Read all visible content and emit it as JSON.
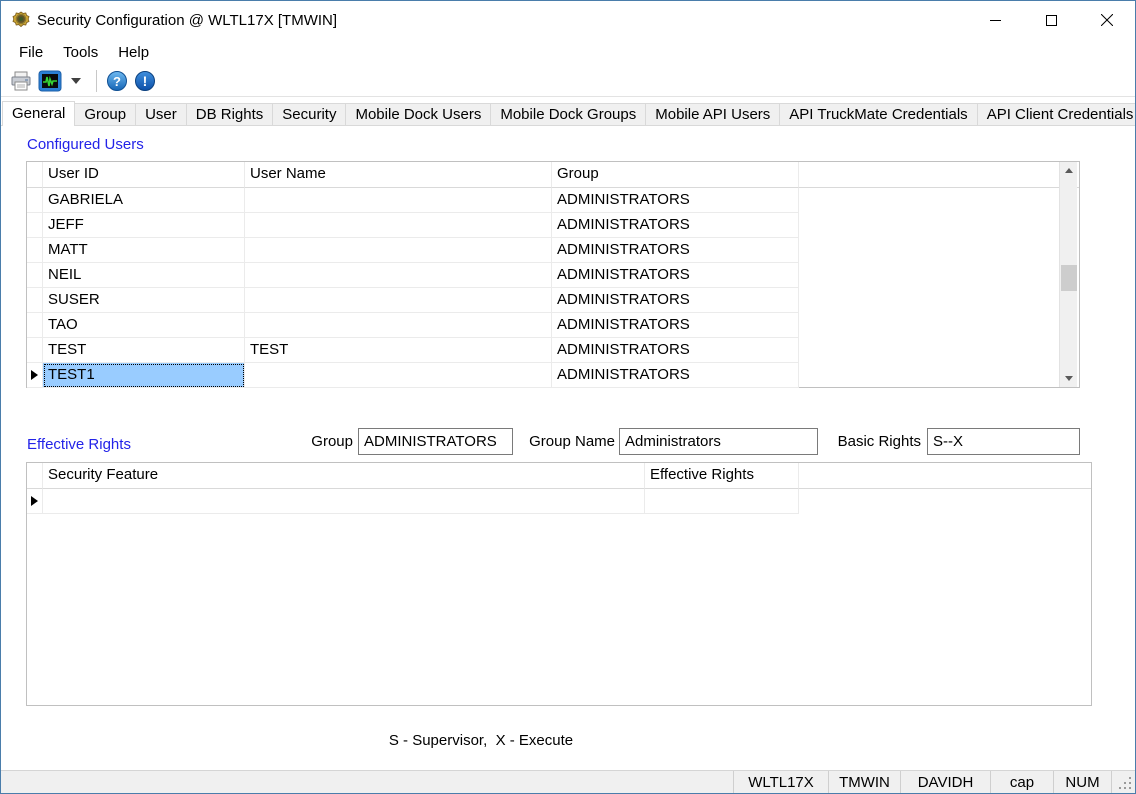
{
  "colors": {
    "window_border": "#4a7dab",
    "section_label_blue": "#2323e8",
    "selected_cell_blue": "#99ccff",
    "grid_line": "#ebebeb"
  },
  "window": {
    "title": "Security Configuration @ WLTL17X [TMWIN]",
    "app_icon": "security-badge-icon",
    "controls": [
      "minimize-icon",
      "maximize-icon",
      "close-icon"
    ]
  },
  "menu": {
    "items": [
      "File",
      "Tools",
      "Help"
    ]
  },
  "toolbar": {
    "buttons": [
      {
        "icon": "printer-icon"
      },
      {
        "icon": "activity-monitor-icon"
      },
      {
        "icon": "dropdown-arrow-icon"
      },
      {
        "icon": "help-icon",
        "glyph": "?"
      },
      {
        "icon": "info-icon",
        "glyph": "!"
      }
    ]
  },
  "tabs": [
    {
      "label": "General",
      "active": true
    },
    {
      "label": "Group",
      "active": false
    },
    {
      "label": "User",
      "active": false
    },
    {
      "label": "DB Rights",
      "active": false
    },
    {
      "label": "Security",
      "active": false
    },
    {
      "label": "Mobile Dock Users",
      "active": false
    },
    {
      "label": "Mobile Dock Groups",
      "active": false
    },
    {
      "label": "Mobile API Users",
      "active": false
    },
    {
      "label": "API TruckMate Credentials",
      "active": false
    },
    {
      "label": "API Client Credentials",
      "active": false
    }
  ],
  "configured_users": {
    "section_label": "Configured Users",
    "columns": [
      "User ID",
      "User Name",
      "Group"
    ],
    "rows": [
      {
        "user_id": "GABRIELA",
        "user_name": "",
        "group": "ADMINISTRATORS",
        "selected": false
      },
      {
        "user_id": "JEFF",
        "user_name": "",
        "group": "ADMINISTRATORS",
        "selected": false
      },
      {
        "user_id": "MATT",
        "user_name": "",
        "group": "ADMINISTRATORS",
        "selected": false
      },
      {
        "user_id": "NEIL",
        "user_name": "",
        "group": "ADMINISTRATORS",
        "selected": false
      },
      {
        "user_id": "SUSER",
        "user_name": "",
        "group": "ADMINISTRATORS",
        "selected": false
      },
      {
        "user_id": "TAO",
        "user_name": "",
        "group": "ADMINISTRATORS",
        "selected": false
      },
      {
        "user_id": "TEST",
        "user_name": "TEST",
        "group": "ADMINISTRATORS",
        "selected": false
      },
      {
        "user_id": "TEST1",
        "user_name": "",
        "group": "ADMINISTRATORS",
        "selected": true
      }
    ]
  },
  "effective_rights": {
    "section_label": "Effective Rights",
    "group_field": {
      "label": "Group",
      "value": "ADMINISTRATORS"
    },
    "group_name_field": {
      "label": "Group Name",
      "value": "Administrators"
    },
    "basic_rights_field": {
      "label": "Basic Rights",
      "value": "S--X"
    },
    "columns": [
      "Security Feature",
      "Effective Rights"
    ]
  },
  "legend": "S - Supervisor,  X - Execute",
  "status_bar": {
    "cells": [
      "WLTL17X",
      "TMWIN",
      "DAVIDH",
      "cap",
      "NUM"
    ]
  }
}
